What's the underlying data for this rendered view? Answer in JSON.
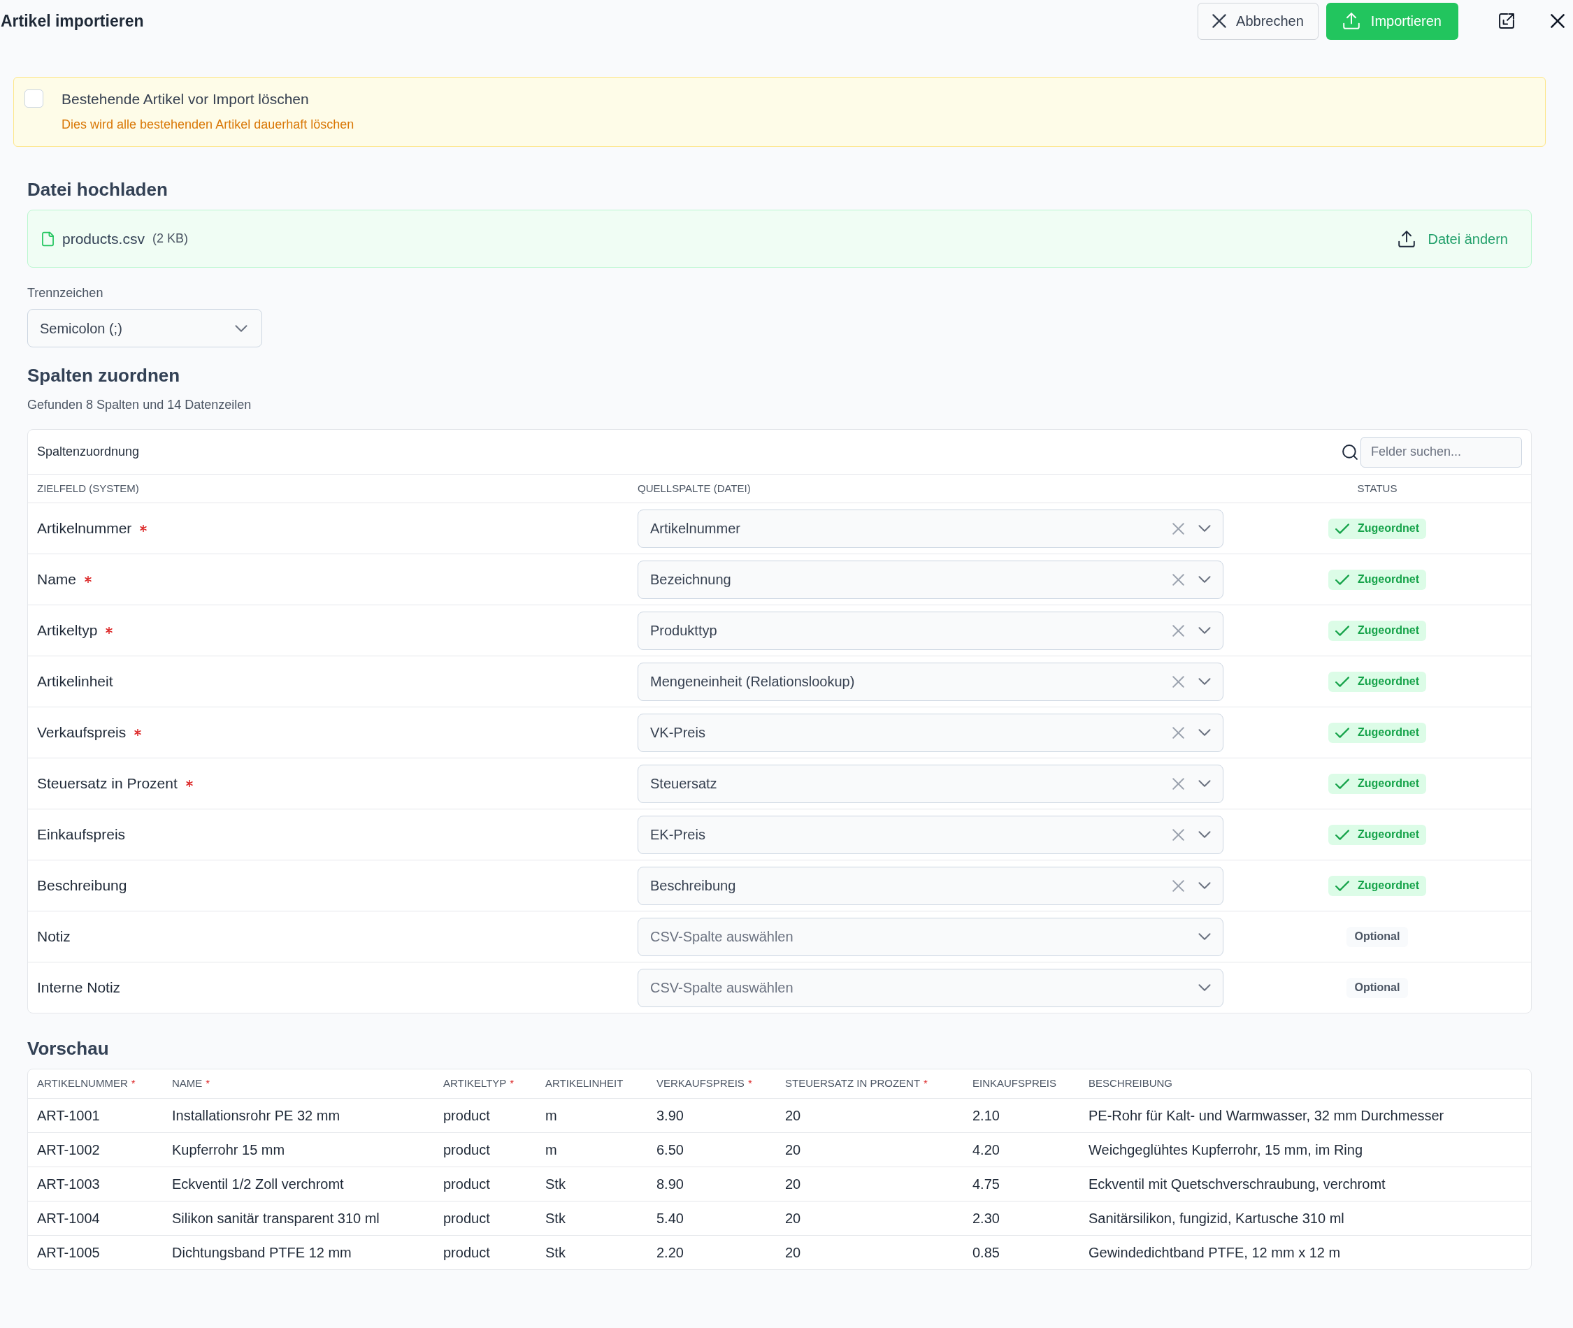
{
  "header": {
    "title": "Artikel importieren",
    "buttons": [
      {
        "label": "Abbrechen",
        "kind": "cancel"
      },
      {
        "label": "Importieren",
        "kind": "primary"
      }
    ]
  },
  "warning": {
    "checked": false,
    "label": "Bestehende Artikel vor Import löschen",
    "hint": "Dies wird alle bestehenden Artikel dauerhaft löschen"
  },
  "upload": {
    "heading": "Datei hochladen",
    "file_name": "products.csv",
    "file_size": "(2 KB)",
    "change_label": "Datei ändern"
  },
  "delimiter": {
    "label": "Trennzeichen",
    "value": "Semicolon (;)"
  },
  "mapping": {
    "heading": "Spalten zuordnen",
    "summary": "Gefunden 8 Spalten und 14 Datenzeilen",
    "card_title": "Spaltenzuordnung",
    "search": {
      "placeholder": "Felder suchen..."
    },
    "columns": [
      "ZIELFELD (SYSTEM)",
      "QUELLSPALTE (DATEI)",
      "STATUS"
    ],
    "rows": [
      {
        "field": "Artikelnummer",
        "required": true,
        "source": "Artikelnummer",
        "status": "Zugeordnet",
        "kind": "mapped"
      },
      {
        "field": "Name",
        "required": true,
        "source": "Bezeichnung",
        "status": "Zugeordnet",
        "kind": "mapped"
      },
      {
        "field": "Artikeltyp",
        "required": true,
        "source": "Produkttyp",
        "status": "Zugeordnet",
        "kind": "mapped"
      },
      {
        "field": "Artikelinheit",
        "required": false,
        "source": "Mengeneinheit (Relationslookup)",
        "status": "Zugeordnet",
        "kind": "mapped"
      },
      {
        "field": "Verkaufspreis",
        "required": true,
        "source": "VK-Preis",
        "status": "Zugeordnet",
        "kind": "mapped"
      },
      {
        "field": "Steuersatz in Prozent",
        "required": true,
        "source": "Steuersatz",
        "status": "Zugeordnet",
        "kind": "mapped"
      },
      {
        "field": "Einkaufspreis",
        "required": false,
        "source": "EK-Preis",
        "status": "Zugeordnet",
        "kind": "mapped"
      },
      {
        "field": "Beschreibung",
        "required": false,
        "source": "Beschreibung",
        "status": "Zugeordnet",
        "kind": "mapped"
      },
      {
        "field": "Notiz",
        "required": false,
        "placeholder": "CSV-Spalte auswählen",
        "status": "Optional",
        "kind": "optional"
      },
      {
        "field": "Interne Notiz",
        "required": false,
        "placeholder": "CSV-Spalte auswählen",
        "status": "Optional",
        "kind": "optional"
      }
    ]
  },
  "preview": {
    "heading": "Vorschau",
    "columns": [
      {
        "label": "ARTIKELNUMMER",
        "required_mark": "*"
      },
      {
        "label": "NAME",
        "required_mark": "*"
      },
      {
        "label": "ARTIKELTYP",
        "required_mark": "*"
      },
      {
        "label": "ARTIKELINHEIT"
      },
      {
        "label": "VERKAUFSPREIS",
        "required_mark": "*"
      },
      {
        "label": "STEUERSATZ IN PROZENT",
        "required_mark": "*"
      },
      {
        "label": "EINKAUFSPREIS"
      },
      {
        "label": "BESCHREIBUNG"
      }
    ],
    "rows": [
      [
        "ART-1001",
        "Installationsrohr PE 32 mm",
        "product",
        "m",
        "3.90",
        "20",
        "2.10",
        "PE-Rohr für Kalt- und Warmwasser, 32 mm Durchmesser"
      ],
      [
        "ART-1002",
        "Kupferrohr 15 mm",
        "product",
        "m",
        "6.50",
        "20",
        "4.20",
        "Weichgeglühtes Kupferrohr, 15 mm, im Ring"
      ],
      [
        "ART-1003",
        "Eckventil 1/2 Zoll verchromt",
        "product",
        "Stk",
        "8.90",
        "20",
        "4.75",
        "Eckventil mit Quetschverschraubung, verchromt"
      ],
      [
        "ART-1004",
        "Silikon sanitär transparent 310 ml",
        "product",
        "Stk",
        "5.40",
        "20",
        "2.30",
        "Sanitärsilikon, fungizid, Kartusche 310 ml"
      ],
      [
        "ART-1005",
        "Dichtungsband PTFE 12 mm",
        "product",
        "Stk",
        "2.20",
        "20",
        "0.85",
        "Gewindedichtband PTFE, 12 mm x 12 m"
      ]
    ]
  }
}
